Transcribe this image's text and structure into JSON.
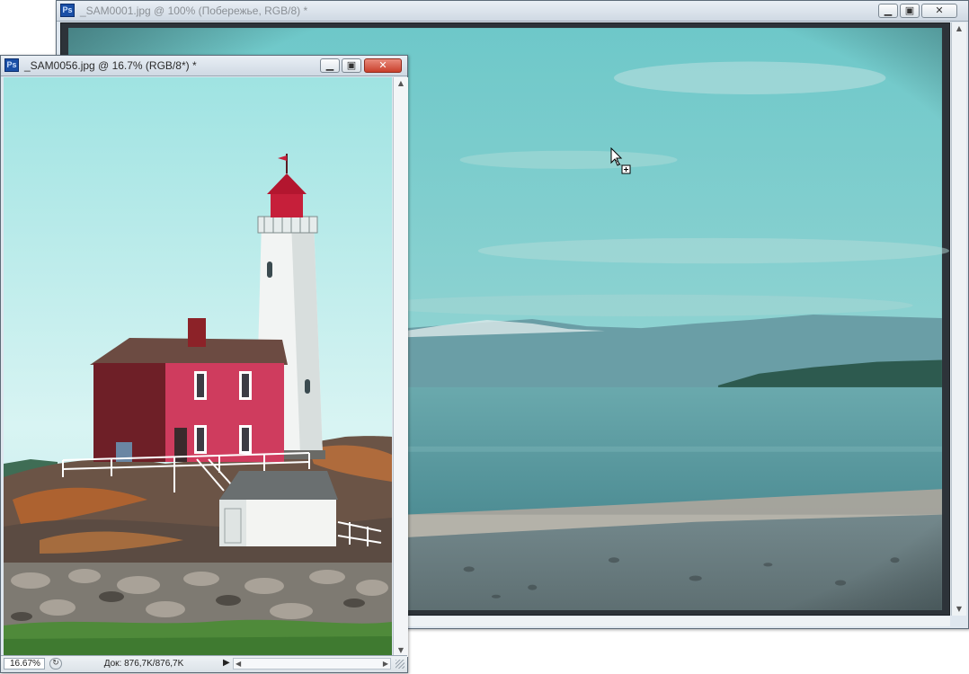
{
  "back_window": {
    "title": "_SAM0001.jpg @ 100% (Побережье, RGB/8) *",
    "icon": "ps-app-icon"
  },
  "front_window": {
    "title": "_SAM0056.jpg @ 16.7% (RGB/8*) *",
    "icon": "ps-app-icon",
    "status": {
      "zoom": "16.67%",
      "doc_info": "Док: 876,7K/876,7K"
    }
  },
  "app_logo_text": "Ps",
  "controls": {
    "minimize": "▁",
    "maximize": "▣",
    "close": "✕",
    "play": "▶",
    "scroll_up": "▲",
    "scroll_down": "▼",
    "scroll_left": "◀",
    "scroll_right": "▶"
  },
  "colors": {
    "sky": "#7fcfcf",
    "sea": "#5d9ea3",
    "house_red": "#c43c5a",
    "active_close": "#c9402c"
  }
}
